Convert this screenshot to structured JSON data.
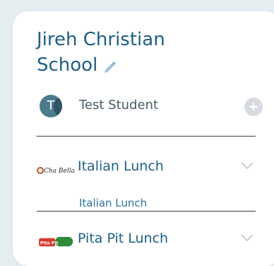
{
  "school": {
    "name_line1": "Jireh Christian",
    "name_line2": "School"
  },
  "student": {
    "initial": "T",
    "name": "Test Student"
  },
  "lunches": [
    {
      "logo": "Cha Bella",
      "title": "Italian Lunch",
      "subtitle": "Italian Lunch"
    },
    {
      "logo": "Pita Pit",
      "title": "Pita Pit Lunch"
    }
  ],
  "colors": {
    "accent": "#1d5f86",
    "link": "#2a73a0",
    "add_button": "#d7dbdf",
    "background": "#e5eef1"
  },
  "icons": {
    "edit": "pencil-icon",
    "add": "plus-icon",
    "expand": "chevron-down-icon"
  }
}
